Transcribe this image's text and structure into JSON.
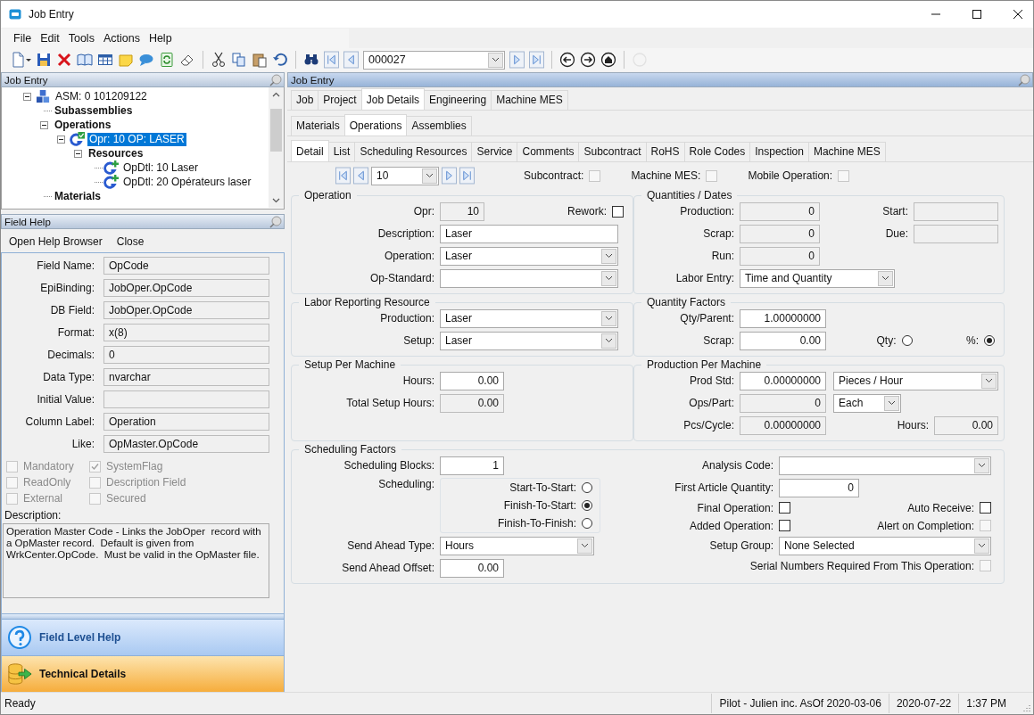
{
  "window": {
    "title": "Job Entry"
  },
  "menu": [
    "File",
    "Edit",
    "Tools",
    "Actions",
    "Help"
  ],
  "toolbar": {
    "record": "000027"
  },
  "tree_panel": {
    "title": "Job Entry",
    "tree": [
      {
        "label": "ASM: 0 101209122",
        "kind": "assembly",
        "selected": false,
        "expanded": true,
        "children": [
          {
            "label": "Subassemblies",
            "kind": "folder",
            "selected": false
          },
          {
            "label": "Operations",
            "kind": "folder",
            "selected": false,
            "expanded": true,
            "children": [
              {
                "label": "Opr: 10 OP: LASER",
                "kind": "operation",
                "selected": true,
                "expanded": true,
                "children": [
                  {
                    "label": "Resources",
                    "kind": "folder",
                    "selected": false,
                    "expanded": true,
                    "children": [
                      {
                        "label": "OpDtl: 10 Laser",
                        "kind": "resource",
                        "selected": false
                      },
                      {
                        "label": "OpDtl: 20 Opérateurs laser",
                        "kind": "resource",
                        "selected": false
                      }
                    ]
                  }
                ]
              }
            ]
          },
          {
            "label": "Materials",
            "kind": "folder",
            "selected": false
          }
        ]
      }
    ]
  },
  "field_help": {
    "title": "Field Help",
    "menu": [
      "Open Help Browser",
      "Close"
    ],
    "fields": [
      {
        "label": "Field Name:",
        "value": "OpCode"
      },
      {
        "label": "EpiBinding:",
        "value": "JobOper.OpCode"
      },
      {
        "label": "DB Field:",
        "value": "JobOper.OpCode"
      },
      {
        "label": "Format:",
        "value": "x(8)"
      },
      {
        "label": "Decimals:",
        "value": "0"
      },
      {
        "label": "Data Type:",
        "value": "nvarchar"
      },
      {
        "label": "Initial Value:"
      },
      {
        "label": "Column Label:",
        "value": "Operation"
      },
      {
        "label": "Like:",
        "value": "OpMaster.OpCode"
      }
    ],
    "flags": [
      {
        "label": "Mandatory",
        "checked": false,
        "disabled": true
      },
      {
        "label": "SystemFlag",
        "checked": true,
        "disabled": true
      },
      {
        "label": "ReadOnly",
        "checked": false,
        "disabled": true
      },
      {
        "label": "Description Field",
        "checked": false,
        "disabled": true
      },
      {
        "label": "External",
        "checked": false,
        "disabled": true
      },
      {
        "label": "Secured",
        "checked": false,
        "disabled": true
      }
    ],
    "description_label": "Description:",
    "description": "Operation Master Code - Links the JobOper  record with a OpMaster record.  Default is given from WrkCenter.OpCode.  Must be valid in the OpMaster file.",
    "sections": [
      {
        "label": "Field Level Help",
        "kind": "help"
      },
      {
        "label": "Technical Details",
        "kind": "tech"
      }
    ]
  },
  "main": {
    "title": "Job Entry",
    "tabs": [
      {
        "label": "Job",
        "selected": false
      },
      {
        "label": "Project",
        "selected": false
      },
      {
        "label": "Job Details",
        "selected": true
      },
      {
        "label": "Engineering",
        "selected": false
      },
      {
        "label": "Machine MES",
        "selected": false
      }
    ],
    "subtabs": [
      {
        "label": "Materials",
        "selected": false
      },
      {
        "label": "Operations",
        "selected": true
      },
      {
        "label": "Assemblies",
        "selected": false
      }
    ],
    "detail_tabs": [
      {
        "label": "Detail",
        "selected": true
      },
      {
        "label": "List",
        "selected": false
      },
      {
        "label": "Scheduling Resources",
        "selected": false
      },
      {
        "label": "Service",
        "selected": false
      },
      {
        "label": "Comments",
        "selected": false
      },
      {
        "label": "Subcontract",
        "selected": false
      },
      {
        "label": "RoHS",
        "selected": false
      },
      {
        "label": "Role Codes",
        "selected": false
      },
      {
        "label": "Inspection",
        "selected": false
      },
      {
        "label": "Machine MES",
        "selected": false
      }
    ],
    "navigator": {
      "value": "10"
    },
    "flags": [
      {
        "label": "Subcontract:",
        "checked": false,
        "disabled": true
      },
      {
        "label": "Machine MES:",
        "checked": false,
        "disabled": true
      },
      {
        "label": "Mobile Operation:",
        "checked": false,
        "disabled": true
      }
    ],
    "groups": [
      {
        "title": "Operation",
        "columns": [
          {
            "rows": [
              {
                "items": [
                  {
                    "kind": "number",
                    "label": "Opr:",
                    "value": "10",
                    "readonly": true
                  },
                  {
                    "kind": "check",
                    "label": "Rework:",
                    "checked": false,
                    "disabled": false
                  }
                ]
              },
              {
                "items": [
                  {
                    "kind": "text",
                    "label": "Description:",
                    "value": "Laser",
                    "readonly": false
                  }
                ]
              },
              {
                "items": [
                  {
                    "kind": "combo",
                    "label": "Operation:",
                    "value": "Laser"
                  }
                ]
              },
              {
                "items": [
                  {
                    "kind": "combo",
                    "label": "Op-Standard:"
                  }
                ]
              }
            ]
          }
        ]
      },
      {
        "title": "Quantities / Dates",
        "columns": [
          {
            "rows": [
              {
                "items": [
                  {
                    "kind": "number",
                    "label": "Production:",
                    "value": "0",
                    "readonly": true
                  },
                  {
                    "kind": "text",
                    "label": "Start:",
                    "readonly": true
                  }
                ]
              },
              {
                "items": [
                  {
                    "kind": "number",
                    "label": "Scrap:",
                    "value": "0",
                    "readonly": true
                  },
                  {
                    "kind": "text",
                    "label": "Due:",
                    "readonly": true
                  }
                ]
              },
              {
                "items": [
                  {
                    "kind": "number",
                    "label": "Run:",
                    "value": "0",
                    "readonly": true
                  }
                ]
              },
              {
                "items": [
                  {
                    "kind": "combo",
                    "label": "Labor Entry:",
                    "value": "Time and Quantity"
                  }
                ]
              }
            ]
          }
        ]
      },
      {
        "title": "Labor Reporting Resource",
        "columns": [
          {
            "rows": [
              {
                "items": [
                  {
                    "kind": "combo",
                    "label": "Production:",
                    "value": "Laser"
                  }
                ]
              },
              {
                "items": [
                  {
                    "kind": "combo",
                    "label": "Setup:",
                    "value": "Laser"
                  }
                ]
              }
            ]
          }
        ]
      },
      {
        "title": "Quantity Factors",
        "columns": [
          {
            "rows": [
              {
                "items": [
                  {
                    "kind": "number",
                    "label": "Qty/Parent:",
                    "value": "1.00000000",
                    "readonly": false
                  }
                ]
              },
              {
                "items": [
                  {
                    "kind": "number",
                    "label": "Scrap:",
                    "value": "0.00",
                    "readonly": false
                  },
                  {
                    "kind": "radio",
                    "label": "Qty:",
                    "selected": false
                  },
                  {
                    "kind": "radio",
                    "label": "%:",
                    "selected": true
                  }
                ]
              }
            ]
          }
        ]
      },
      {
        "title": "Setup Per Machine",
        "columns": [
          {
            "rows": [
              {
                "items": [
                  {
                    "kind": "number",
                    "label": "Hours:",
                    "value": "0.00",
                    "readonly": false
                  }
                ]
              },
              {
                "items": [
                  {
                    "kind": "number",
                    "label": "Total Setup Hours:",
                    "value": "0.00",
                    "readonly": true
                  }
                ]
              }
            ]
          }
        ]
      },
      {
        "title": "Production Per Machine",
        "columns": [
          {
            "rows": [
              {
                "items": [
                  {
                    "kind": "number",
                    "label": "Prod Std:",
                    "value": "0.00000000",
                    "readonly": false
                  },
                  {
                    "kind": "combo",
                    "value": "Pieces / Hour"
                  }
                ]
              },
              {
                "items": [
                  {
                    "kind": "number",
                    "label": "Ops/Part:",
                    "value": "0",
                    "readonly": true
                  },
                  {
                    "kind": "combo",
                    "value": "Each"
                  }
                ]
              },
              {
                "items": [
                  {
                    "kind": "number",
                    "label": "Pcs/Cycle:",
                    "value": "0.00000000",
                    "readonly": true
                  },
                  {
                    "kind": "number",
                    "label": "Hours:",
                    "value": "0.00",
                    "readonly": true
                  }
                ]
              }
            ]
          }
        ]
      },
      {
        "title": "Scheduling Factors",
        "columns": [
          {
            "rows": [
              {
                "items": [
                  {
                    "kind": "number",
                    "label": "Scheduling Blocks:",
                    "value": "1",
                    "readonly": false
                  }
                ]
              },
              {
                "items": [
                  {
                    "kind": "radiogroup",
                    "label": "Scheduling:",
                    "options": [
                      {
                        "label": "Start-To-Start:",
                        "selected": false
                      },
                      {
                        "label": "Finish-To-Start:",
                        "selected": true
                      },
                      {
                        "label": "Finish-To-Finish:",
                        "selected": false
                      }
                    ]
                  }
                ]
              },
              {
                "items": [
                  {
                    "kind": "combo",
                    "label": "Send Ahead Type:",
                    "value": "Hours"
                  }
                ]
              },
              {
                "items": [
                  {
                    "kind": "number",
                    "label": "Send Ahead Offset:",
                    "value": "0.00",
                    "readonly": false
                  }
                ]
              }
            ]
          },
          {
            "rows": [
              {
                "items": [
                  {
                    "kind": "combo",
                    "label": "Analysis Code:"
                  }
                ]
              },
              {
                "items": [
                  {
                    "kind": "number",
                    "label": "First Article Quantity:",
                    "value": "0",
                    "readonly": false
                  }
                ]
              },
              {
                "items": [
                  {
                    "kind": "check",
                    "label": "Final Operation:",
                    "checked": false,
                    "disabled": false
                  },
                  {
                    "kind": "check",
                    "label": "Auto Receive:",
                    "checked": false,
                    "disabled": false
                  }
                ]
              },
              {
                "items": [
                  {
                    "kind": "check",
                    "label": "Added Operation:",
                    "checked": false,
                    "disabled": false
                  },
                  {
                    "kind": "check",
                    "label": "Alert on Completion:",
                    "checked": false,
                    "disabled": true
                  }
                ]
              },
              {
                "items": [
                  {
                    "kind": "combo",
                    "label": "Setup Group:",
                    "value": "None Selected"
                  }
                ]
              },
              {
                "items": [
                  {
                    "kind": "check",
                    "label": "Serial Numbers Required From This Operation:",
                    "checked": false,
                    "disabled": true
                  }
                ]
              }
            ]
          }
        ]
      }
    ]
  },
  "status_bar": {
    "message": "Ready",
    "panels": [
      "Pilot - Julien inc. AsOf 2020-03-06",
      "2020-07-22",
      "1:37 PM"
    ]
  }
}
